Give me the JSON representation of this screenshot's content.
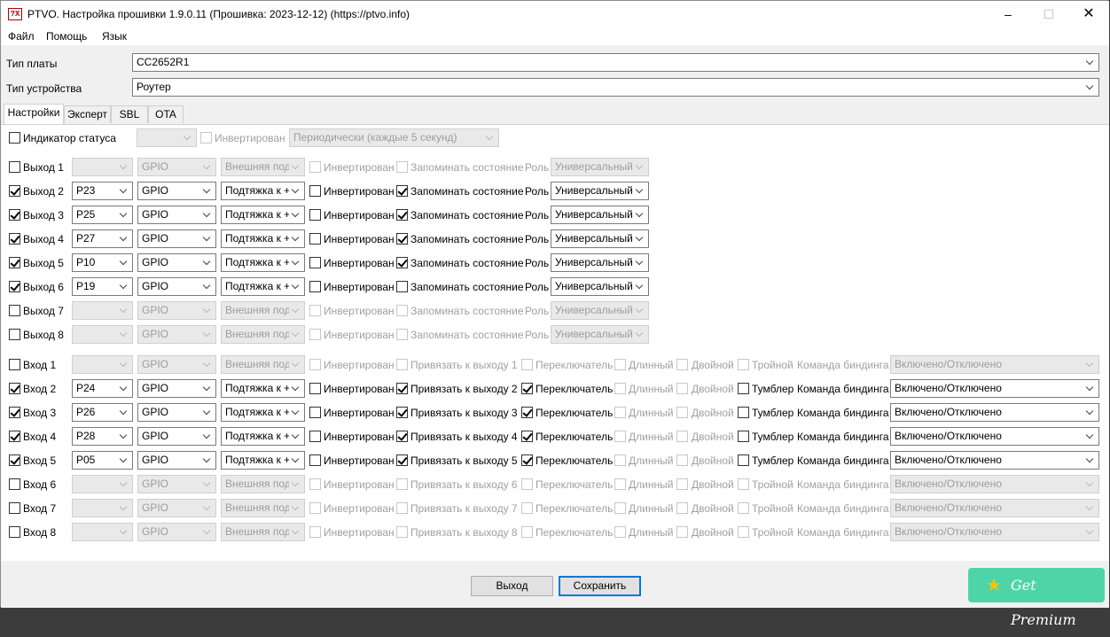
{
  "window": {
    "title": "PTVO. Настройка прошивки 1.9.0.11 (Прошивка: 2023-12-12) (https://ptvo.info)",
    "icon_text": "?X",
    "controls": [
      "minimize-icon",
      "maximize-icon",
      "close-icon"
    ]
  },
  "menu": [
    "Файл",
    "Помощь",
    "Язык"
  ],
  "board": {
    "label": "Тип платы",
    "value": "CC2652R1"
  },
  "device": {
    "label": "Тип устройства",
    "value": "Роутер"
  },
  "tabs": [
    "Настройки",
    "Эксперт",
    "SBL",
    "OTA"
  ],
  "status": {
    "label": "Индикатор статуса",
    "pin": "",
    "inverted": "Инвертирован",
    "mode": "Периодически (каждые 5 секунд)"
  },
  "output_labels": {
    "inverted": "Инвертирован",
    "remember": "Запоминать состояние",
    "role": "Роль"
  },
  "outputs": [
    {
      "name": "Выход 1",
      "enabled": false,
      "pin": "",
      "type": "GPIO",
      "pull": "Внешняя подт",
      "inverted": false,
      "remember": false,
      "role": "Универсальный"
    },
    {
      "name": "Выход 2",
      "enabled": true,
      "pin": "P23",
      "type": "GPIO",
      "pull": "Подтяжка к +",
      "inverted": false,
      "remember": true,
      "role": "Универсальный"
    },
    {
      "name": "Выход 3",
      "enabled": true,
      "pin": "P25",
      "type": "GPIO",
      "pull": "Подтяжка к +",
      "inverted": false,
      "remember": true,
      "role": "Универсальный"
    },
    {
      "name": "Выход 4",
      "enabled": true,
      "pin": "P27",
      "type": "GPIO",
      "pull": "Подтяжка к +",
      "inverted": false,
      "remember": true,
      "role": "Универсальный"
    },
    {
      "name": "Выход 5",
      "enabled": true,
      "pin": "P10",
      "type": "GPIO",
      "pull": "Подтяжка к +",
      "inverted": false,
      "remember": true,
      "role": "Универсальный"
    },
    {
      "name": "Выход 6",
      "enabled": true,
      "pin": "P19",
      "type": "GPIO",
      "pull": "Подтяжка к +",
      "inverted": false,
      "remember": false,
      "role": "Универсальный"
    },
    {
      "name": "Выход 7",
      "enabled": false,
      "pin": "",
      "type": "GPIO",
      "pull": "Внешняя подт",
      "inverted": false,
      "remember": false,
      "role": "Универсальный"
    },
    {
      "name": "Выход 8",
      "enabled": false,
      "pin": "",
      "type": "GPIO",
      "pull": "Внешняя подт",
      "inverted": false,
      "remember": false,
      "role": "Универсальный"
    }
  ],
  "input_labels": {
    "inverted": "Инвертирован",
    "switch": "Переключатель",
    "long": "Длинный",
    "double": "Двойной",
    "command": "Команда биндинга"
  },
  "inputs": [
    {
      "name": "Вход 1",
      "enabled": false,
      "pin": "",
      "type": "GPIO",
      "pull": "Внешняя подт",
      "inverted": false,
      "bind": false,
      "bind_label": "Привязать к выходу 1",
      "switch": false,
      "long": false,
      "double": false,
      "triple": false,
      "triple_label": "Тройной",
      "command": "Включено/Отключено"
    },
    {
      "name": "Вход 2",
      "enabled": true,
      "pin": "P24",
      "type": "GPIO",
      "pull": "Подтяжка к +",
      "inverted": false,
      "bind": true,
      "bind_label": "Привязать к выходу 2",
      "switch": true,
      "long": false,
      "double": false,
      "triple": false,
      "triple_label": "Тумблер",
      "command": "Включено/Отключено"
    },
    {
      "name": "Вход 3",
      "enabled": true,
      "pin": "P26",
      "type": "GPIO",
      "pull": "Подтяжка к +",
      "inverted": false,
      "bind": true,
      "bind_label": "Привязать к выходу 3",
      "switch": true,
      "long": false,
      "double": false,
      "triple": false,
      "triple_label": "Тумблер",
      "command": "Включено/Отключено"
    },
    {
      "name": "Вход 4",
      "enabled": true,
      "pin": "P28",
      "type": "GPIO",
      "pull": "Подтяжка к +",
      "inverted": false,
      "bind": true,
      "bind_label": "Привязать к выходу 4",
      "switch": true,
      "long": false,
      "double": false,
      "triple": false,
      "triple_label": "Тумблер",
      "command": "Включено/Отключено"
    },
    {
      "name": "Вход 5",
      "enabled": true,
      "pin": "P05",
      "type": "GPIO",
      "pull": "Подтяжка к +",
      "inverted": false,
      "bind": true,
      "bind_label": "Привязать к выходу 5",
      "switch": true,
      "long": false,
      "double": false,
      "triple": false,
      "triple_label": "Тумблер",
      "command": "Включено/Отключено"
    },
    {
      "name": "Вход 6",
      "enabled": false,
      "pin": "",
      "type": "GPIO",
      "pull": "Внешняя подт",
      "inverted": false,
      "bind": false,
      "bind_label": "Привязать к выходу 6",
      "switch": false,
      "long": false,
      "double": false,
      "triple": false,
      "triple_label": "Тройной",
      "command": "Включено/Отключено"
    },
    {
      "name": "Вход 7",
      "enabled": false,
      "pin": "",
      "type": "GPIO",
      "pull": "Внешняя подт",
      "inverted": false,
      "bind": false,
      "bind_label": "Привязать к выходу 7",
      "switch": false,
      "long": false,
      "double": false,
      "triple": false,
      "triple_label": "Тройной",
      "command": "Включено/Отключено"
    },
    {
      "name": "Вход 8",
      "enabled": false,
      "pin": "",
      "type": "GPIO",
      "pull": "Внешняя подт",
      "inverted": false,
      "bind": false,
      "bind_label": "Привязать к выходу 8",
      "switch": false,
      "long": false,
      "double": false,
      "triple": false,
      "triple_label": "Тройной",
      "command": "Включено/Отключено"
    }
  ],
  "buttons": {
    "exit": "Выход",
    "save": "Сохранить"
  },
  "premium": {
    "label": "Get Premium",
    "icon": "star-icon"
  },
  "colors": {
    "premium_bg": "#4fd4a8",
    "accent": "#0078d7"
  }
}
